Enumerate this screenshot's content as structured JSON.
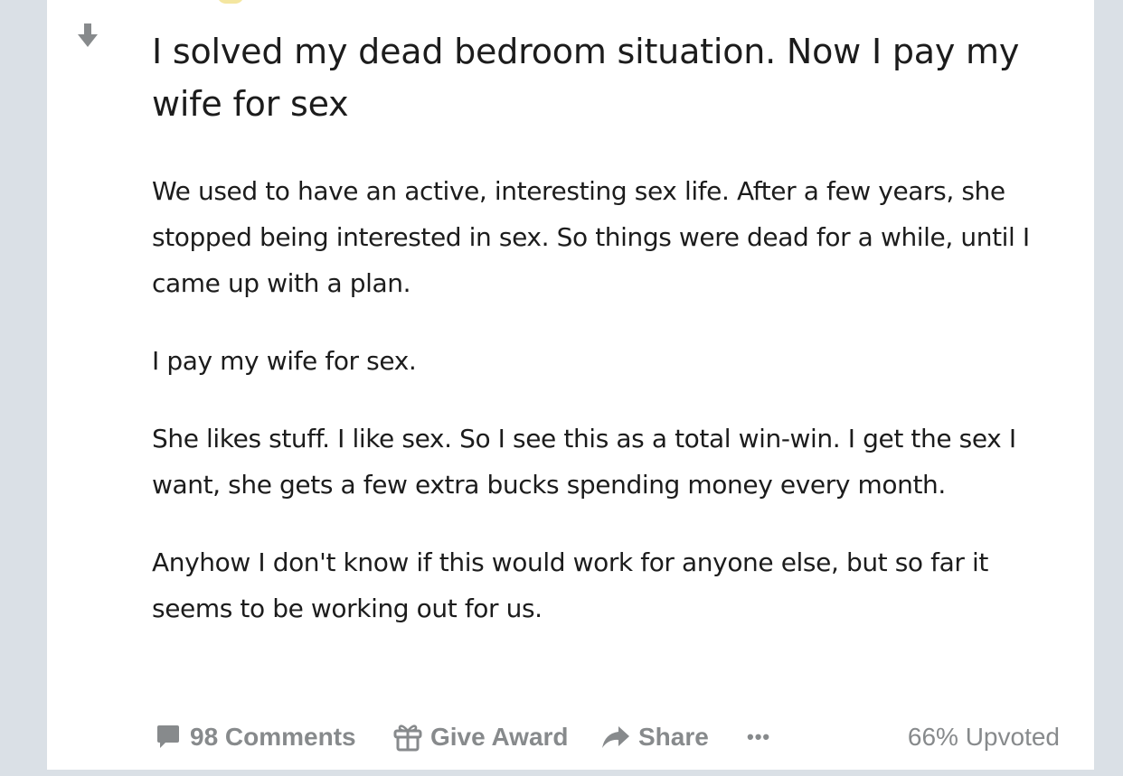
{
  "post": {
    "title": "I solved my dead bedroom situation. Now I pay my wife for sex",
    "body": [
      "We used to have an active, interesting sex life. After a few years, she stopped being interested in sex. So things were dead for a while, until I came up with a plan.",
      "I pay my wife for sex.",
      "She likes stuff. I like sex. So I see this as a total win-win. I get the sex I want, she gets a few extra bucks spending money every month.",
      "Anyhow I don't know if this would work for anyone else, but so far it seems to be working out for us."
    ]
  },
  "actions": {
    "comments_label": "98 Comments",
    "award_label": "Give Award",
    "share_label": "Share",
    "more_label": "•••",
    "upvoted_label": "66% Upvoted"
  },
  "icons": {
    "vote": "downvote-arrow-icon",
    "comments": "comment-bubble-icon",
    "award": "gift-icon",
    "share": "share-arrow-icon",
    "more": "more-dots-icon"
  },
  "colors": {
    "page_background": "#dae0e6",
    "card_background": "#ffffff",
    "text": "#1c1c1c",
    "muted": "#878a8c"
  }
}
